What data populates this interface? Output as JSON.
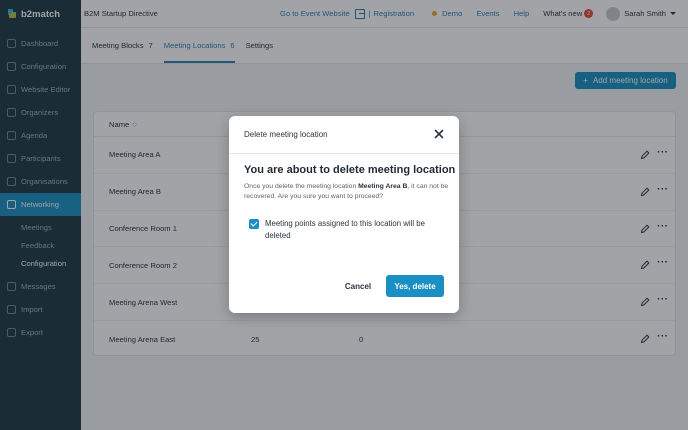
{
  "app": {
    "logo_text": "b2match"
  },
  "sidebar": {
    "items": [
      {
        "label": "Dashboard",
        "icon": "dashboard-icon"
      },
      {
        "label": "Configuration",
        "icon": "gear-icon"
      },
      {
        "label": "Website Editor",
        "icon": "website-icon"
      },
      {
        "label": "Organizers",
        "icon": "organizers-icon"
      },
      {
        "label": "Agenda",
        "icon": "agenda-icon"
      },
      {
        "label": "Participants",
        "icon": "participants-icon"
      },
      {
        "label": "Organisations",
        "icon": "organisations-icon"
      },
      {
        "label": "Networking",
        "icon": "networking-icon"
      },
      {
        "label": "Messages",
        "icon": "messages-icon"
      },
      {
        "label": "Import",
        "icon": "import-icon"
      },
      {
        "label": "Export",
        "icon": "export-icon"
      }
    ],
    "subitems": [
      {
        "label": "Meetings"
      },
      {
        "label": "Feedback"
      },
      {
        "label": "Configuration"
      }
    ]
  },
  "topbar": {
    "event_name": "B2M Startup Directive",
    "go_to_event": "Go to Event Website",
    "registration": "Registration",
    "separator": "|",
    "demo": "Demo",
    "events": "Events",
    "help": "Help",
    "whats_new": "What's new",
    "whats_new_count": "2",
    "user_name": "Sarah Smith"
  },
  "tabs": [
    {
      "label": "Meeting Blocks",
      "count": "7"
    },
    {
      "label": "Meeting Locations",
      "count": "6"
    },
    {
      "label": "Settings",
      "count": ""
    }
  ],
  "toolbar": {
    "add_label": "Add meeting location",
    "add_icon": "+"
  },
  "table": {
    "header_name": "Name",
    "sort_icon": "◇",
    "rows": [
      {
        "name": "Meeting Area A",
        "col2": "",
        "col3": ""
      },
      {
        "name": "Meeting Area B",
        "col2": "",
        "col3": ""
      },
      {
        "name": "Conference Room 1",
        "col2": "",
        "col3": ""
      },
      {
        "name": "Conference Room 2",
        "col2": "",
        "col3": ""
      },
      {
        "name": "Meeting Arena West",
        "col2": "",
        "col3": ""
      },
      {
        "name": "Meeting Arena East",
        "col2": "25",
        "col3": "0"
      }
    ],
    "more_icon": "···"
  },
  "modal": {
    "header": "Delete meeting location",
    "title": "You are about to delete meeting location",
    "text_before": "Once you delete the meeting location ",
    "location_name": "Meeting Area B",
    "text_after": ", it can not be recovered. Are you sure you want to proceed?",
    "checkbox_label": "Meeting points assigned to this location will be deleted",
    "checkbox_checked": true,
    "cancel_label": "Cancel",
    "confirm_label": "Yes, delete"
  },
  "colors": {
    "accent": "#1a8fc4",
    "sidebar": "#1e3a44",
    "link": "#2d7fb0"
  }
}
